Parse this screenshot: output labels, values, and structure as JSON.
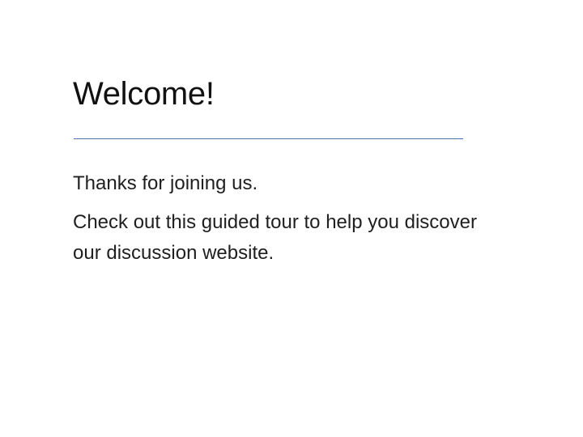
{
  "slide": {
    "title": "Welcome!",
    "paragraphs": [
      "Thanks for joining us.",
      "Check out this guided tour to help you discover our discussion website."
    ]
  },
  "colors": {
    "background": "#ffffff",
    "text": "#1f1f1f",
    "rule": "#4a6fb5"
  }
}
